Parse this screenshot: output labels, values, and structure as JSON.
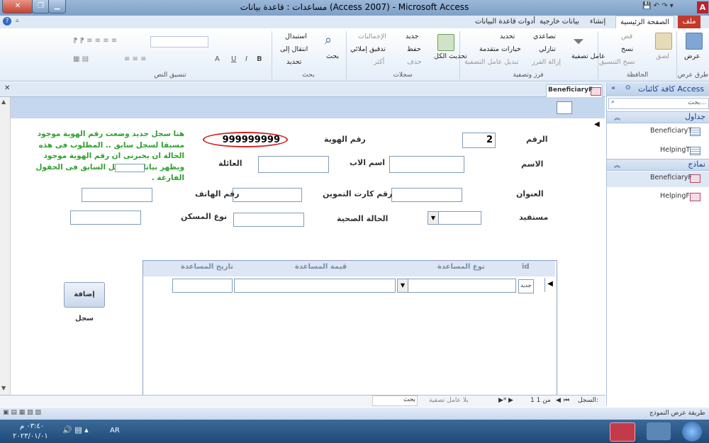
{
  "window": {
    "title": "مساعدات : قاعدة بيانات (Access 2007) - Microsoft Access",
    "app_icon_letter": "A"
  },
  "ribbon_tabs": {
    "file": "ملف",
    "home": "الصفحة الرئيسية",
    "create": "إنشاء",
    "external": "بيانات خارجية",
    "dbtools": "أدوات قاعدة البيانات"
  },
  "ribbon": {
    "views": {
      "view": "عرض",
      "label": "طرق عرض"
    },
    "clipboard": {
      "paste": "لصق",
      "cut": "قص",
      "copy": "نسخ",
      "format_painter": "نسخ التنسيق",
      "label": "الحافظة"
    },
    "sort_filter": {
      "filter": "عامل تصفية",
      "ascending": "تصاعدي",
      "descending": "تنازلي",
      "remove_sort": "إزالة الفرز",
      "selection": "تحديد",
      "advanced": "خيارات متقدمة",
      "toggle_filter": "تبديل عامل التصفية",
      "label": "فرز وتصفية"
    },
    "records": {
      "refresh": "تحديث الكل",
      "new": "جديد",
      "save": "حفظ",
      "delete": "حذف",
      "totals": "الإجماليات",
      "spelling": "تدقيق إملائي",
      "more": "أكثر",
      "label": "سجلات"
    },
    "find": {
      "find": "بحث",
      "replace": "استبدال",
      "goto": "انتقال إلى",
      "select": "تحديد",
      "label": "بحث"
    },
    "text_format": {
      "label": "تنسيق النص",
      "bold": "B",
      "italic": "I",
      "underline": "U",
      "font_color": "A"
    }
  },
  "nav": {
    "header": "كافة كائنات Access",
    "search_placeholder": "بحث...",
    "tables_label": "جداول",
    "tables": [
      "BeneficiaryT",
      "HelpingT"
    ],
    "forms_label": "نماذج",
    "forms": [
      "BeneficiaryF",
      "HelpingF"
    ]
  },
  "doc_tab": "BeneficiaryF",
  "form": {
    "labels": {
      "number": "الرقم",
      "id_number": "رقم الهوية",
      "name": "الاسم",
      "father_name": "اسم الاب",
      "family": "العائلة",
      "address": "العنوان",
      "ration_card": "رقم كارت التموين",
      "phone": "رقم الهاتف",
      "beneficiary": "مستفيد",
      "health": "الحالة الصحية",
      "housing": "نوع المسكن"
    },
    "values": {
      "number": "2",
      "id_number": "999999999"
    },
    "note": "هنا سجل جديد وضعت رقم الهوية موجود مسبقا لسجل سابق .. المطلوب فى هذه الحالة ان يخبرنى ان رقم الهوية موجود ويظهر بيانات السجل السابق فى الحقول الفارغة .",
    "add_record_button": "إضافة سجل"
  },
  "subform": {
    "headers": [
      "id",
      "نوع المساعدة",
      "قيمة المساعدة",
      "تاريخ المساعدة"
    ],
    "new_row_id": "جديد"
  },
  "record_nav": {
    "label": "السجل:",
    "position": "1 من 1",
    "filter_status": "بلا عامل تصفية",
    "search": "بحث"
  },
  "status": {
    "view_name": "طريقة عرض النموذج"
  },
  "taskbar": {
    "lang": "AR",
    "time": "٠٣:٤٠ م",
    "date": "٢٠٢٣/٠١/٠١"
  }
}
